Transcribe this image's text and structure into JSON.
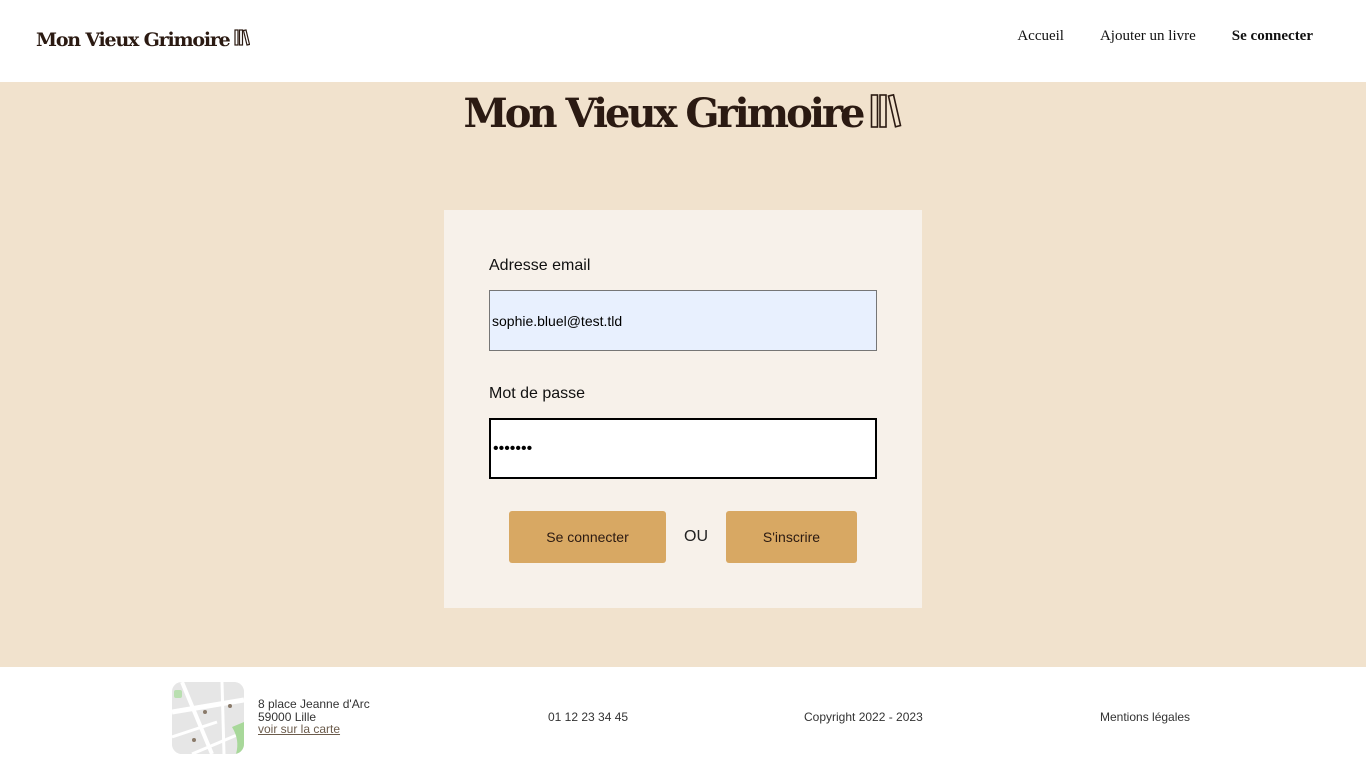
{
  "header": {
    "logo_text": "Mon Vieux Grimoire",
    "nav": [
      {
        "label": "Accueil"
      },
      {
        "label": "Ajouter un livre"
      },
      {
        "label": "Se connecter"
      }
    ]
  },
  "main": {
    "logo_text": "Mon Vieux Grimoire",
    "form": {
      "email_label": "Adresse email",
      "email_value": "sophie.bluel@test.tld",
      "password_label": "Mot de passe",
      "password_value": "•••••••",
      "login_button": "Se connecter",
      "separator": "OU",
      "signup_button": "S'inscrire"
    }
  },
  "footer": {
    "address_line1": "8 place Jeanne d'Arc",
    "address_line2": "59000 Lille",
    "map_link": "voir sur la carte",
    "phone": "01 12 23 34 45",
    "copyright": "Copyright 2022 - 2023",
    "legal": "Mentions légales"
  },
  "colors": {
    "background": "#f1e2cd",
    "card": "#f7f1ea",
    "button": "#d8a863",
    "brand_text": "#2b1a12"
  },
  "icons": [
    "books-icon",
    "map-thumbnail"
  ]
}
